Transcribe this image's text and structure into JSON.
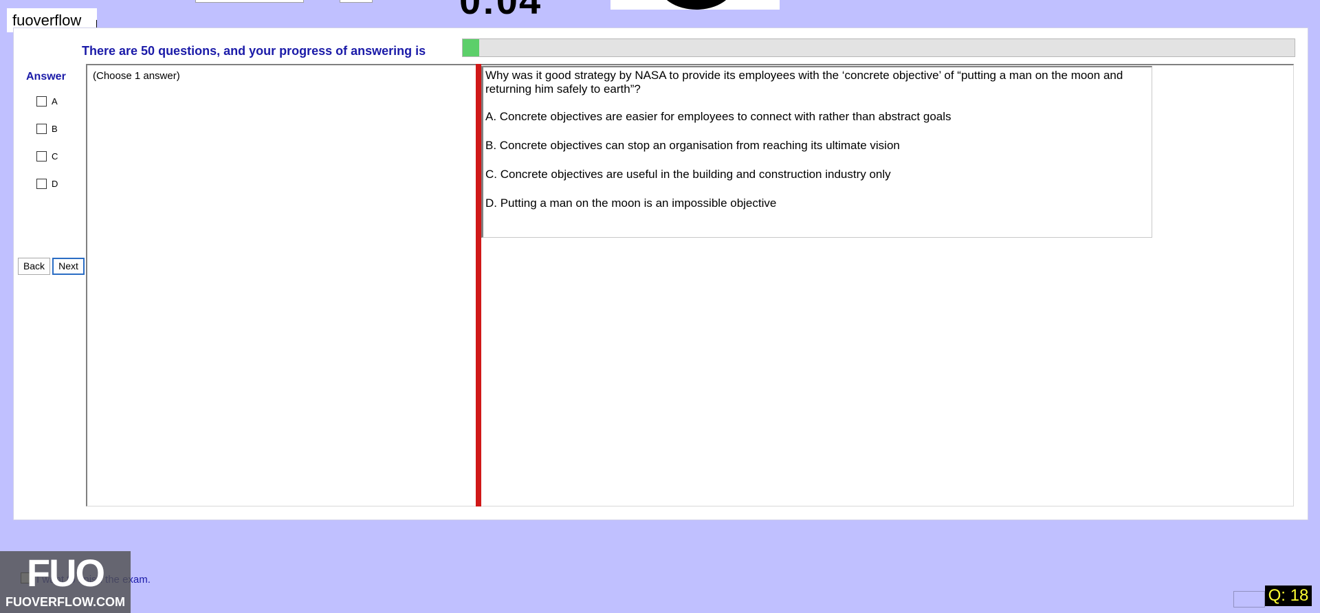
{
  "app": {
    "watermark": "fuoverflow"
  },
  "progress": {
    "label": "There are 50 questions, and your progress of answering is",
    "fraction": 0.02
  },
  "answer_panel": {
    "title": "Answer",
    "options": [
      "A",
      "B",
      "C",
      "D"
    ]
  },
  "nav": {
    "back_label": "Back",
    "next_label": "Next"
  },
  "instructions": {
    "text": "(Choose 1 answer)"
  },
  "question": {
    "text": "Why was it good strategy by NASA to provide its employees with the ‘concrete objective’ of “putting a man on the moon and returning him safely to earth”?",
    "choices": [
      "A.  Concrete objectives are easier for employees to connect with rather than abstract goals",
      "B.  Concrete objectives can stop an organisation from reaching its ultimate vision",
      "C.  Concrete objectives are useful in the building and construction industry only",
      "D.  Putting a man on the moon is an impossible objective"
    ]
  },
  "finish": {
    "label": "I want to finish the exam."
  },
  "logo": {
    "big": "FUO",
    "small": "FUOVERFLOW.COM"
  },
  "question_indicator": "Q: 18",
  "colors": {
    "background": "#c0c0ff",
    "label_blue": "#1a1aa8",
    "progress_fill": "#5ccf6a",
    "divider_red": "#d01818",
    "indicator_text": "#ffff33"
  }
}
